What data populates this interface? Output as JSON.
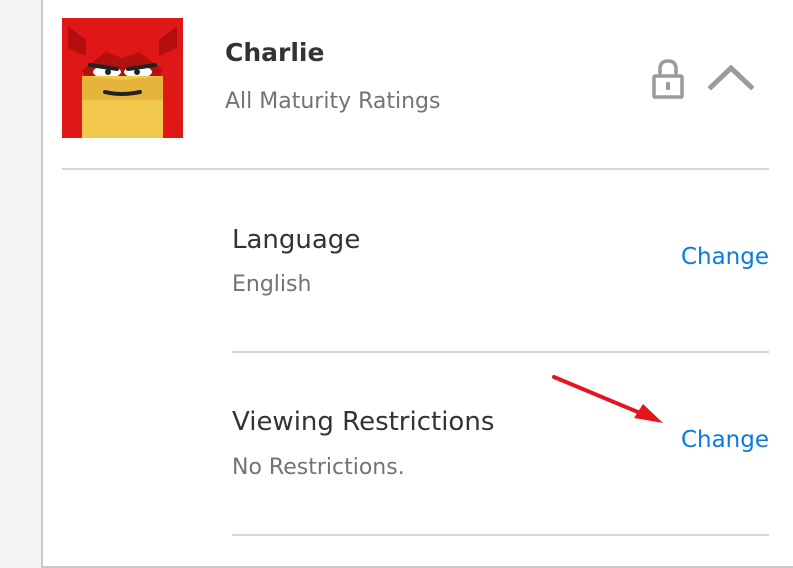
{
  "profile": {
    "name": "Charlie",
    "maturity": "All Maturity Ratings",
    "avatar_icon": "superhero-avatar-icon"
  },
  "header_icons": {
    "lock": "lock-icon",
    "collapse": "chevron-up-icon"
  },
  "settings": {
    "language": {
      "title": "Language",
      "value": "English",
      "action": "Change"
    },
    "viewing_restrictions": {
      "title": "Viewing Restrictions",
      "value": "No Restrictions.",
      "action": "Change"
    }
  },
  "colors": {
    "link": "#0a7be2",
    "annotation": "#e4141d"
  }
}
